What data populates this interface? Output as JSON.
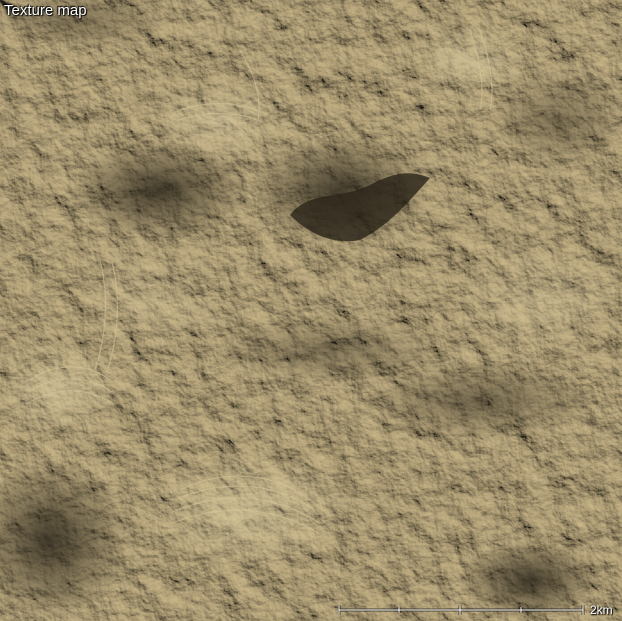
{
  "map": {
    "title": "Texture map",
    "view": "shaded-relief-terrain",
    "palette": {
      "base": "#8c7b55",
      "highlight": "#cbb98c",
      "shadow": "#3a3120",
      "deep_shadow": "#24201a",
      "strata": "#bfb08a"
    }
  },
  "scale": {
    "label": "2km",
    "divisions": 4
  }
}
